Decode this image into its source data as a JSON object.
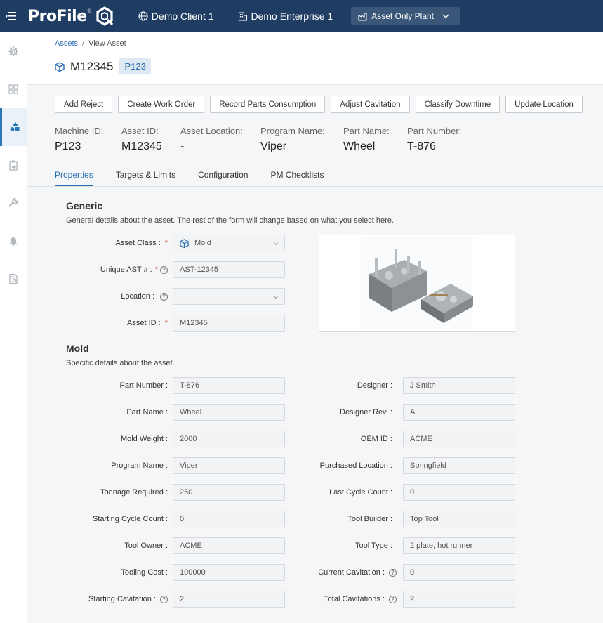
{
  "app": {
    "logo_text": "ProFile",
    "logo_reg": "®"
  },
  "topnav": {
    "client": "Demo Client 1",
    "enterprise": "Demo Enterprise 1",
    "plant": "Asset Only Plant"
  },
  "sidebar": {
    "items": [
      "gear-icon",
      "dashboard-icon",
      "assets-icon",
      "clipboard-icon",
      "wrench-icon",
      "bell-icon",
      "report-icon"
    ],
    "active_index": 2
  },
  "breadcrumb": {
    "root": "Assets",
    "separator": "/",
    "current": "View Asset"
  },
  "asset": {
    "title": "M12345",
    "badge": "P123"
  },
  "actions": [
    "Add Reject",
    "Create Work Order",
    "Record Parts Consumption",
    "Adjust Cavitation",
    "Classify Downtime",
    "Update Location"
  ],
  "info": [
    {
      "label": "Machine ID:",
      "value": "P123"
    },
    {
      "label": "Asset ID:",
      "value": "M12345"
    },
    {
      "label": "Asset Location:",
      "value": "-"
    },
    {
      "label": "Program Name:",
      "value": "Viper"
    },
    {
      "label": "Part Name:",
      "value": "Wheel"
    },
    {
      "label": "Part Number:",
      "value": "T-876"
    }
  ],
  "tabs": [
    "Properties",
    "Targets & Limits",
    "Configuration",
    "PM Checklists"
  ],
  "active_tab": 0,
  "generic": {
    "title": "Generic",
    "desc": "General details about the asset. The rest of the form will change based on what you select here.",
    "fields": [
      {
        "label": "Asset Class :",
        "value": "Mold",
        "required": "*"
      },
      {
        "label": "Unique AST # :",
        "value": "AST-12345",
        "required": "*"
      },
      {
        "label": "Location :",
        "value": ""
      },
      {
        "label": "Asset ID :",
        "value": "M12345",
        "required": "*"
      }
    ]
  },
  "mold": {
    "title": "Mold",
    "desc": "Specific details about the asset.",
    "left": [
      {
        "label": "Part Number :",
        "value": "T-876"
      },
      {
        "label": "Part Name :",
        "value": "Wheel"
      },
      {
        "label": "Mold Weight :",
        "value": "2000"
      },
      {
        "label": "Program Name :",
        "value": "Viper"
      },
      {
        "label": "Tonnage Required :",
        "value": "250"
      },
      {
        "label": "Starting Cycle Count :",
        "value": "0"
      },
      {
        "label": "Tool Owner :",
        "value": "ACME"
      },
      {
        "label": "Tooling Cost :",
        "value": "100000"
      },
      {
        "label": "Starting Cavitation :",
        "value": "2"
      }
    ],
    "right": [
      {
        "label": "Designer :",
        "value": "J Smith"
      },
      {
        "label": "Designer Rev. :",
        "value": "A"
      },
      {
        "label": "OEM ID :",
        "value": "ACME"
      },
      {
        "label": "Purchased Location :",
        "value": "Springfield"
      },
      {
        "label": "Last Cycle Count :",
        "value": "0"
      },
      {
        "label": "Tool Builder :",
        "value": "Top Tool"
      },
      {
        "label": "Tool Type :",
        "value": "2 plate, hot runner"
      },
      {
        "label": "Current Cavitation :",
        "value": "0"
      },
      {
        "label": "Total Cavitations :",
        "value": "2"
      }
    ]
  },
  "colors": {
    "topbar": "#1f3d63",
    "accent": "#2a6fb0",
    "required": "#d9534f"
  }
}
